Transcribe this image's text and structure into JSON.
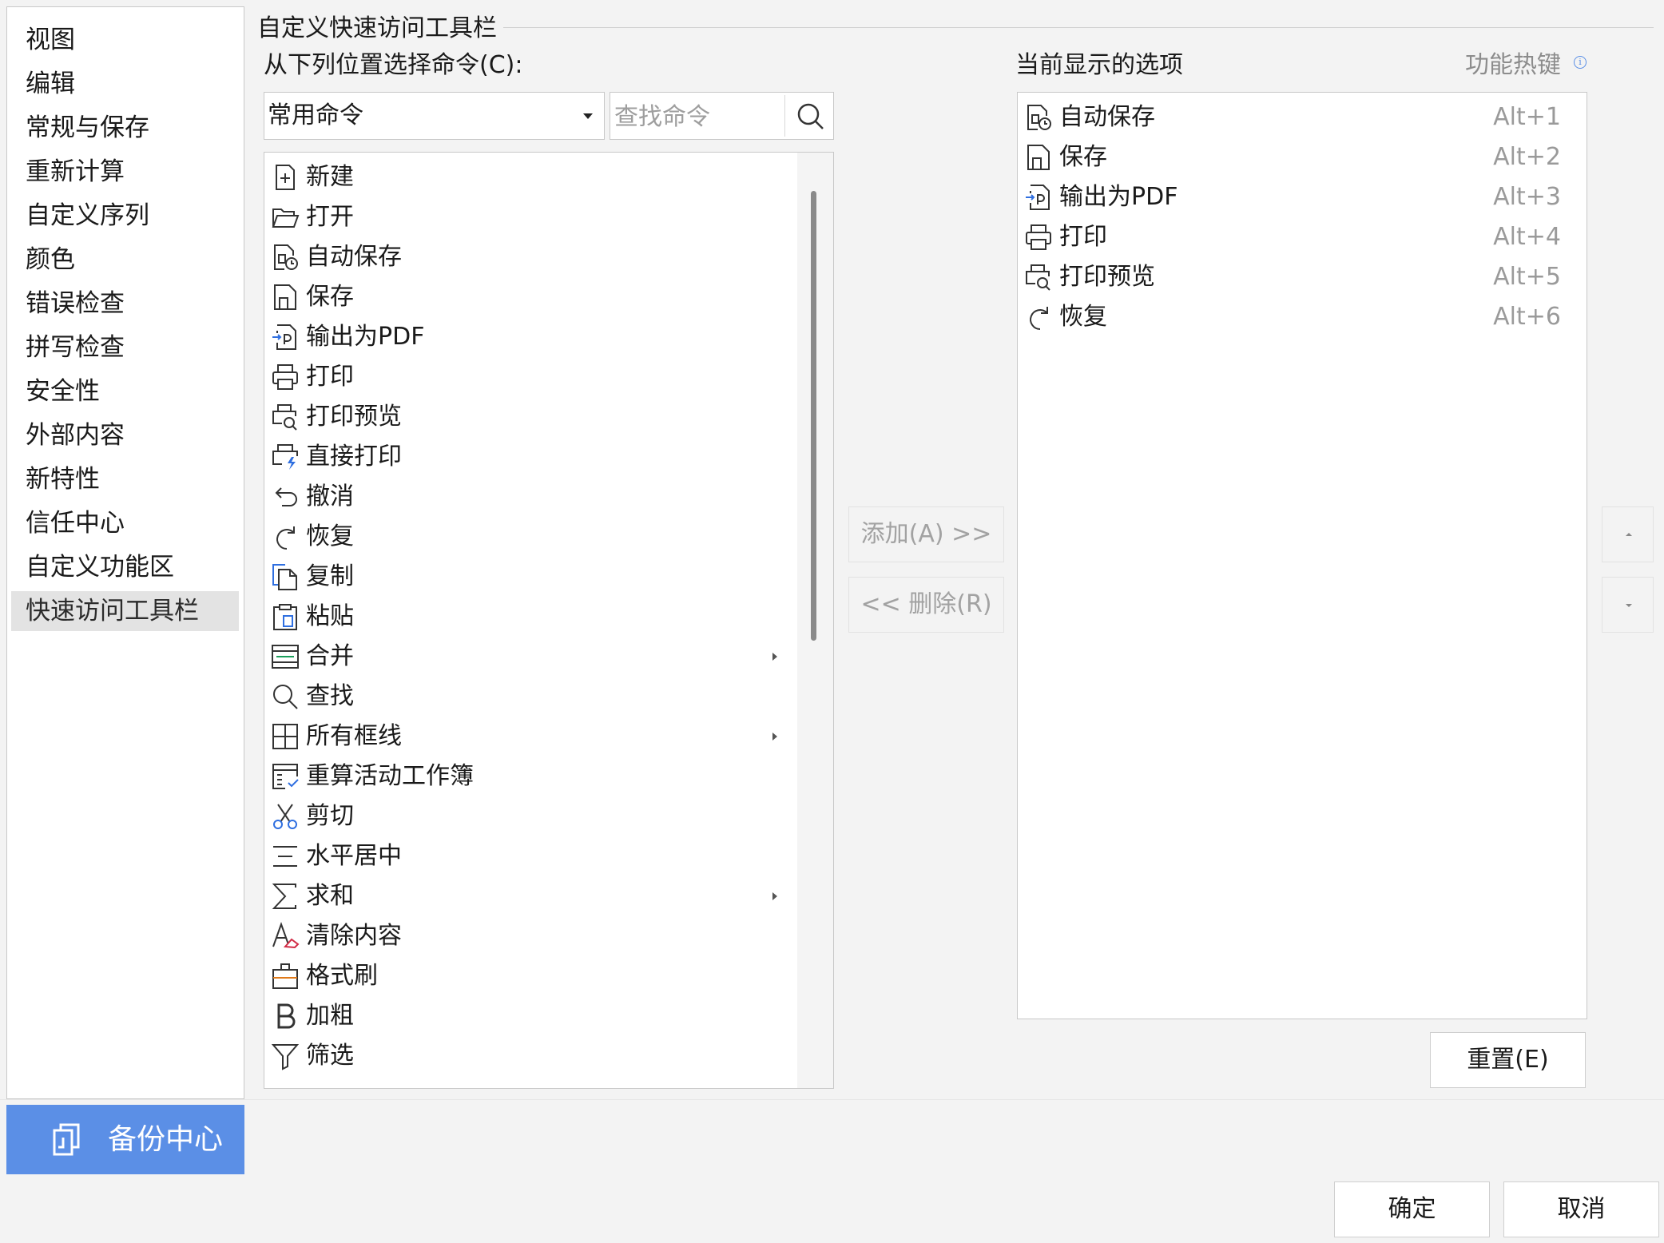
{
  "sidebar": {
    "items": [
      {
        "label": "视图"
      },
      {
        "label": "编辑"
      },
      {
        "label": "常规与保存"
      },
      {
        "label": "重新计算"
      },
      {
        "label": "自定义序列"
      },
      {
        "label": "颜色"
      },
      {
        "label": "错误检查"
      },
      {
        "label": "拼写检查"
      },
      {
        "label": "安全性"
      },
      {
        "label": "外部内容"
      },
      {
        "label": "新特性"
      },
      {
        "label": "信任中心"
      },
      {
        "label": "自定义功能区"
      },
      {
        "label": "快速访问工具栏",
        "selected": true
      }
    ],
    "backup_label": "备份中心",
    "backup_icon": "backup-icon"
  },
  "section_title": "自定义快速访问工具栏",
  "source": {
    "label": "从下列位置选择命令(C):",
    "selected": "常用命令",
    "search_placeholder": "查找命令",
    "commands": [
      {
        "label": "新建",
        "icon": "new-doc-icon"
      },
      {
        "label": "打开",
        "icon": "folder-open-icon"
      },
      {
        "label": "自动保存",
        "icon": "autosave-icon"
      },
      {
        "label": "保存",
        "icon": "save-icon"
      },
      {
        "label": "输出为PDF",
        "icon": "export-pdf-icon"
      },
      {
        "label": "打印",
        "icon": "print-icon"
      },
      {
        "label": "打印预览",
        "icon": "print-preview-icon"
      },
      {
        "label": "直接打印",
        "icon": "direct-print-icon"
      },
      {
        "label": "撤消",
        "icon": "undo-icon"
      },
      {
        "label": "恢复",
        "icon": "redo-icon"
      },
      {
        "label": "复制",
        "icon": "copy-icon"
      },
      {
        "label": "粘贴",
        "icon": "paste-icon"
      },
      {
        "label": "合并",
        "icon": "merge-icon",
        "submenu": true
      },
      {
        "label": "查找",
        "icon": "find-icon"
      },
      {
        "label": "所有框线",
        "icon": "all-borders-icon",
        "submenu": true
      },
      {
        "label": "重算活动工作簿",
        "icon": "recalc-icon"
      },
      {
        "label": "剪切",
        "icon": "cut-icon"
      },
      {
        "label": "水平居中",
        "icon": "align-center-icon"
      },
      {
        "label": "求和",
        "icon": "sum-icon",
        "submenu": true
      },
      {
        "label": "清除内容",
        "icon": "clear-content-icon"
      },
      {
        "label": "格式刷",
        "icon": "format-painter-icon"
      },
      {
        "label": "加粗",
        "icon": "bold-icon"
      },
      {
        "label": "筛选",
        "icon": "filter-icon"
      }
    ]
  },
  "buttons": {
    "add": "添加(A) >>",
    "remove": "<< 删除(R)",
    "reset": "重置(E)",
    "ok": "确定",
    "cancel": "取消"
  },
  "current": {
    "label": "当前显示的选项",
    "hotkey_label": "功能热键",
    "items": [
      {
        "label": "自动保存",
        "key": "Alt+1",
        "icon": "autosave-icon"
      },
      {
        "label": "保存",
        "key": "Alt+2",
        "icon": "save-icon"
      },
      {
        "label": "输出为PDF",
        "key": "Alt+3",
        "icon": "export-pdf-icon"
      },
      {
        "label": "打印",
        "key": "Alt+4",
        "icon": "print-icon"
      },
      {
        "label": "打印预览",
        "key": "Alt+5",
        "icon": "print-preview-icon"
      },
      {
        "label": "恢复",
        "key": "Alt+6",
        "icon": "redo-icon"
      }
    ]
  },
  "colors": {
    "accent": "#5b8fe6",
    "selected_bg": "#e3e3e3",
    "disabled_text": "#a2a2a2",
    "hotkey_text": "#9a9a9a"
  }
}
